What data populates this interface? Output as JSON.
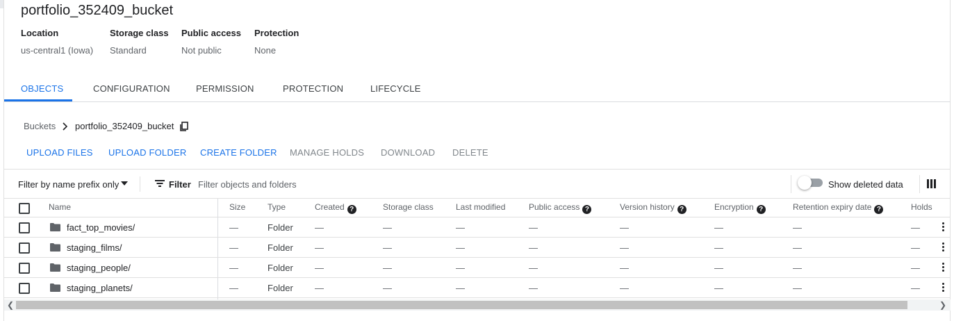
{
  "bucket": {
    "name": "portfolio_352409_bucket",
    "meta": [
      {
        "label": "Location",
        "value": "us-central1 (Iowa)"
      },
      {
        "label": "Storage class",
        "value": "Standard"
      },
      {
        "label": "Public access",
        "value": "Not public"
      },
      {
        "label": "Protection",
        "value": "None"
      }
    ]
  },
  "tabs": [
    "OBJECTS",
    "CONFIGURATION",
    "PERMISSION",
    "PROTECTION",
    "LIFECYCLE"
  ],
  "breadcrumb": {
    "root": "Buckets",
    "current": "portfolio_352409_bucket"
  },
  "actions": [
    "UPLOAD FILES",
    "UPLOAD FOLDER",
    "CREATE FOLDER",
    "MANAGE HOLDS",
    "DOWNLOAD",
    "DELETE"
  ],
  "filter": {
    "mode": "Filter by name prefix only",
    "label": "Filter",
    "placeholder": "Filter objects and folders",
    "show_deleted": "Show deleted data"
  },
  "columns": [
    "Name",
    "Size",
    "Type",
    "Created",
    "Storage class",
    "Last modified",
    "Public access",
    "Version history",
    "Encryption",
    "Retention expiry date",
    "Holds"
  ],
  "rows": [
    {
      "name": "fact_top_movies/",
      "type": "Folder",
      "dash": "—"
    },
    {
      "name": "staging_films/",
      "type": "Folder",
      "dash": "—"
    },
    {
      "name": "staging_people/",
      "type": "Folder",
      "dash": "—"
    },
    {
      "name": "staging_planets/",
      "type": "Folder",
      "dash": "—"
    }
  ],
  "colors": {
    "accent": "#1a73e8",
    "text": "#202124",
    "muted": "#5f6368"
  }
}
